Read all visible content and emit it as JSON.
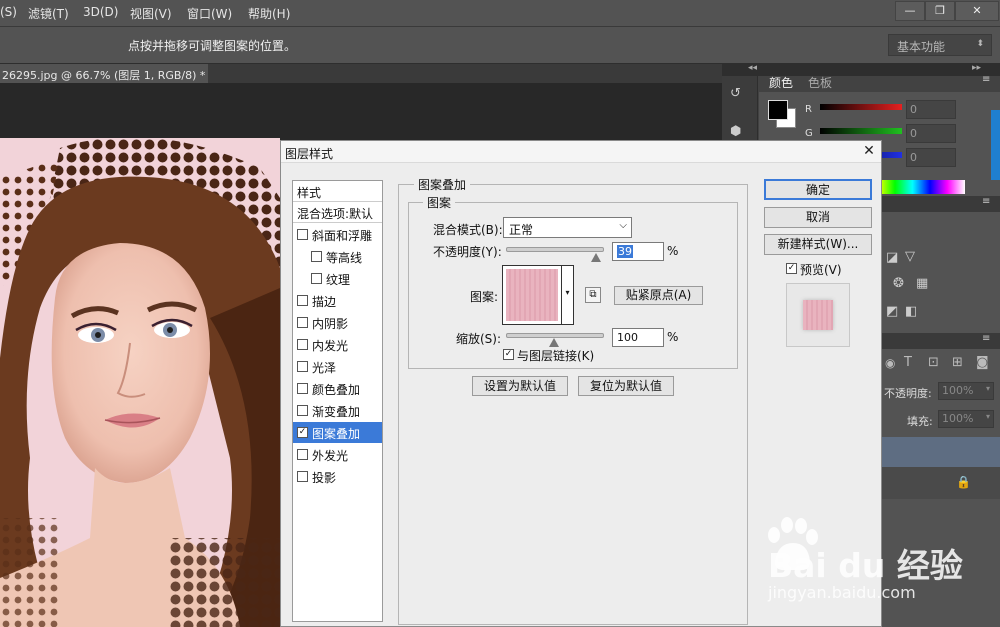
{
  "menu": {
    "items": [
      "(S)",
      "滤镜(T)",
      "3D(D)",
      "视图(V)",
      "窗口(W)",
      "帮助(H)"
    ]
  },
  "window_controls": [
    "—",
    "❐",
    "✕"
  ],
  "options_bar": {
    "hint": "点按并拖移可调整图案的位置。",
    "workspace": "基本功能"
  },
  "document": {
    "tab_title": "26295.jpg @ 66.7% (图层 1, RGB/8) *",
    "tab_close": "×"
  },
  "color_panel": {
    "tabs": [
      "颜色",
      "色板"
    ],
    "channels": [
      {
        "label": "R",
        "value": "0"
      },
      {
        "label": "G",
        "value": "0"
      },
      {
        "label": "B",
        "value": "0"
      }
    ]
  },
  "layers_panel": {
    "opacity_label": "不透明度:",
    "opacity_value": "100%",
    "fill_label": "填充:",
    "fill_value": "100%"
  },
  "dialog": {
    "title": "图层样式",
    "close": "✕",
    "styles": [
      {
        "label": "样式",
        "checkbox": false,
        "header": true
      },
      {
        "label": "混合选项:默认",
        "checkbox": false,
        "header": true
      },
      {
        "label": "斜面和浮雕",
        "checkbox": true,
        "checked": false,
        "indent": 0
      },
      {
        "label": "等高线",
        "checkbox": true,
        "checked": false,
        "indent": 1
      },
      {
        "label": "纹理",
        "checkbox": true,
        "checked": false,
        "indent": 1
      },
      {
        "label": "描边",
        "checkbox": true,
        "checked": false,
        "indent": 0
      },
      {
        "label": "内阴影",
        "checkbox": true,
        "checked": false,
        "indent": 0
      },
      {
        "label": "内发光",
        "checkbox": true,
        "checked": false,
        "indent": 0
      },
      {
        "label": "光泽",
        "checkbox": true,
        "checked": false,
        "indent": 0
      },
      {
        "label": "颜色叠加",
        "checkbox": true,
        "checked": false,
        "indent": 0
      },
      {
        "label": "渐变叠加",
        "checkbox": true,
        "checked": false,
        "indent": 0
      },
      {
        "label": "图案叠加",
        "checkbox": true,
        "checked": true,
        "indent": 0,
        "selected": true
      },
      {
        "label": "外发光",
        "checkbox": true,
        "checked": false,
        "indent": 0
      },
      {
        "label": "投影",
        "checkbox": true,
        "checked": false,
        "indent": 0
      }
    ],
    "section_title": "图案叠加",
    "group_title": "图案",
    "blend_mode_label": "混合模式(B):",
    "blend_mode_value": "正常",
    "opacity_label": "不透明度(Y):",
    "opacity_value": "39",
    "opacity_level": 0.39,
    "percent": "%",
    "pattern_label": "图案:",
    "snap_origin_button": "贴紧原点(A)",
    "scale_label": "缩放(S):",
    "scale_value": "100",
    "link_label": "与图层链接(K)",
    "link_checked": true,
    "set_default_button": "设置为默认值",
    "reset_default_button": "复位为默认值",
    "ok_button": "确定",
    "cancel_button": "取消",
    "new_style_button": "新建样式(W)...",
    "preview_label": "预览(V)",
    "preview_checked": true
  },
  "watermark": {
    "brand": "Bai du 经验",
    "url": "jingyan.baidu.com"
  },
  "colors": {
    "dialog_bg": "#ededed",
    "selected": "#3b7ad8",
    "pattern_pink": "#e9b3bf",
    "photo_pink": "#e8b7c0"
  }
}
